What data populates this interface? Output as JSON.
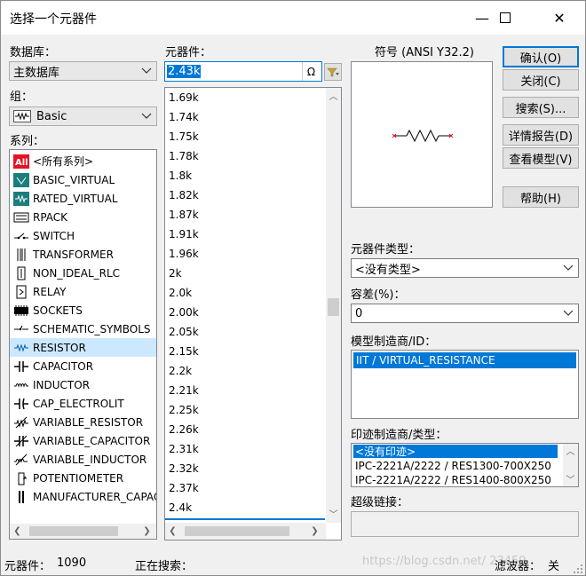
{
  "window": {
    "title": "选择一个元器件",
    "minimize_glyph": "—",
    "maximize_glyph": "☐",
    "close_glyph": "✕"
  },
  "left": {
    "database_label": "数据库：",
    "database_value": "主数据库",
    "group_label": "组：",
    "group_value": "Basic",
    "family_label": "系列：",
    "families": [
      {
        "label": "<所有系列>",
        "icon": "all-icon"
      },
      {
        "label": "BASIC_VIRTUAL",
        "icon": "basic-virtual-icon"
      },
      {
        "label": "RATED_VIRTUAL",
        "icon": "rated-virtual-icon"
      },
      {
        "label": "RPACK",
        "icon": "rpack-icon"
      },
      {
        "label": "SWITCH",
        "icon": "switch-icon"
      },
      {
        "label": "TRANSFORMER",
        "icon": "transformer-icon"
      },
      {
        "label": "NON_IDEAL_RLC",
        "icon": "non-ideal-rlc-icon"
      },
      {
        "label": "RELAY",
        "icon": "relay-icon"
      },
      {
        "label": "SOCKETS",
        "icon": "sockets-icon"
      },
      {
        "label": "SCHEMATIC_SYMBOLS",
        "icon": "schematic-symbols-icon"
      },
      {
        "label": "RESISTOR",
        "icon": "resistor-icon"
      },
      {
        "label": "CAPACITOR",
        "icon": "capacitor-icon"
      },
      {
        "label": "INDUCTOR",
        "icon": "inductor-icon"
      },
      {
        "label": "CAP_ELECTROLIT",
        "icon": "cap-electrolit-icon"
      },
      {
        "label": "VARIABLE_RESISTOR",
        "icon": "variable-resistor-icon"
      },
      {
        "label": "VARIABLE_CAPACITOR",
        "icon": "variable-capacitor-icon"
      },
      {
        "label": "VARIABLE_INDUCTOR",
        "icon": "variable-inductor-icon"
      },
      {
        "label": "POTENTIOMETER",
        "icon": "potentiometer-icon"
      },
      {
        "label": "MANUFACTURER_CAPAC",
        "icon": "manufacturer-capacitor-icon"
      }
    ],
    "all_badge": "All"
  },
  "middle": {
    "component_label": "元器件：",
    "search_value": "2.43k",
    "ohm_glyph": "Ω",
    "components": [
      "1.69k",
      "1.74k",
      "1.75k",
      "1.78k",
      "1.8k",
      "1.82k",
      "1.87k",
      "1.91k",
      "1.96k",
      "2k",
      "2.0k",
      "2.00k",
      "2.05k",
      "2.15k",
      "2.2k",
      "2.21k",
      "2.25k",
      "2.26k",
      "2.31k",
      "2.32k",
      "2.37k",
      "2.4k"
    ]
  },
  "symbol": {
    "label": "符号 (ANSI Y32.2)"
  },
  "buttons": {
    "confirm": "确认(O)",
    "confirm_key": "O",
    "close": "关闭(C)",
    "search": "搜索(S)...",
    "detail": "详情报告(D)",
    "view_model": "查看模型(V)",
    "help": "帮助(H)"
  },
  "right": {
    "component_type_label": "元器件类型：",
    "component_type_value": "<没有类型>",
    "tolerance_label": "容差(%)：",
    "tolerance_value": "0",
    "model_mfr_label": "模型制造商/ID：",
    "model_items": [
      "IIT / VIRTUAL_RESISTANCE"
    ],
    "footprint_label": "印迹制造商/类型：",
    "footprint_items": [
      "<没有印迹>",
      "IPC-2221A/2222 / RES1300-700X250",
      "IPC-2221A/2222 / RES1400-800X250"
    ],
    "hyperlink_label": "超级链接："
  },
  "status": {
    "count_label": "元器件：",
    "count_value": "1090",
    "searching_label": "正在搜索：",
    "filter_label": "滤波器：",
    "filter_value": "关",
    "watermark": "https://blog.csdn.net/ 23459"
  },
  "colors": {
    "selection": "#0078d7",
    "hover": "#cce8ff",
    "accent_red": "#e81123"
  }
}
